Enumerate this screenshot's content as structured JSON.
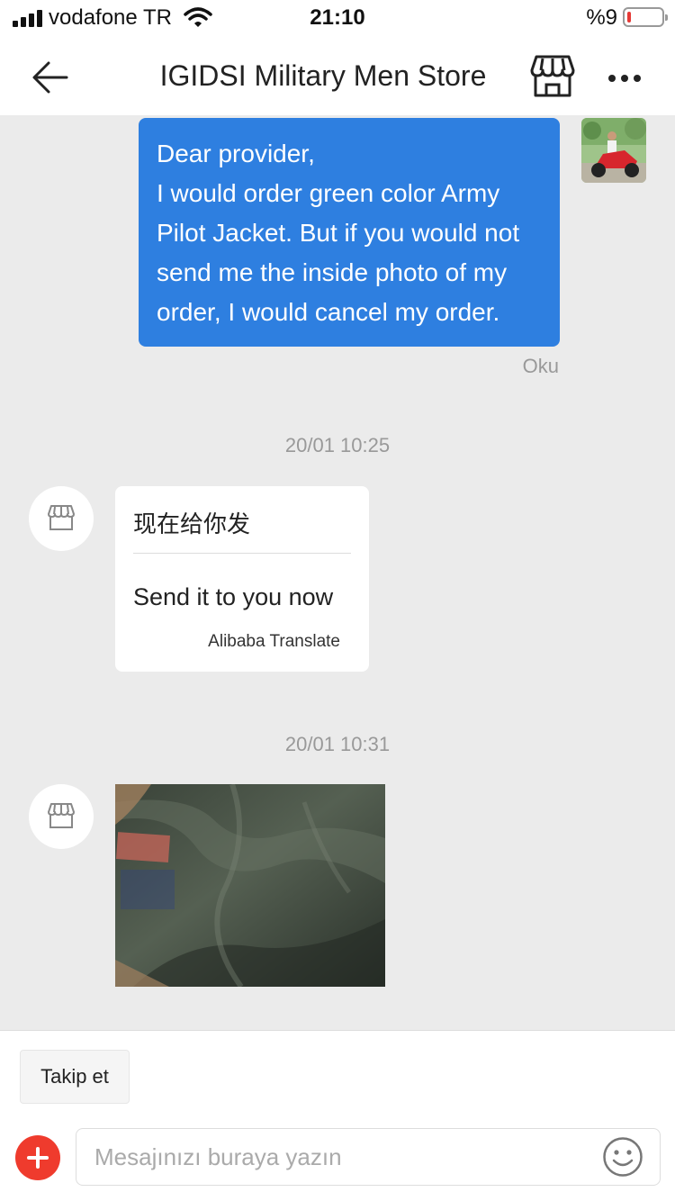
{
  "status_bar": {
    "carrier": "vodafone TR",
    "time": "21:10",
    "battery_text": "%9",
    "battery_level": 0.09
  },
  "header": {
    "title": "IGIDSI Military Men Store",
    "icons": [
      "back-arrow-icon",
      "store-icon",
      "more-icon"
    ]
  },
  "chat": {
    "outgoing": {
      "lines": [
        "Dear provider,",
        "I would order green color Army",
        "Pilot Jacket. But if you would not",
        "send me the inside photo of my",
        "order, I would cancel my order."
      ],
      "status": "Oku"
    },
    "timestamp_1": "20/01 10:25",
    "incoming_text": {
      "original": "现在给你发",
      "translated": "Send it to you now",
      "credit": "Alibaba Translate"
    },
    "timestamp_2": "20/01 10:31"
  },
  "footer": {
    "follow_label": "Takip et",
    "input_placeholder": "Mesajınızı buraya yazın",
    "icons": [
      "plus-icon",
      "emoji-icon"
    ]
  },
  "colors": {
    "outgoing_bubble": "#2e7fe0",
    "background": "#ebebeb",
    "add_button": "#ef3b2d"
  }
}
